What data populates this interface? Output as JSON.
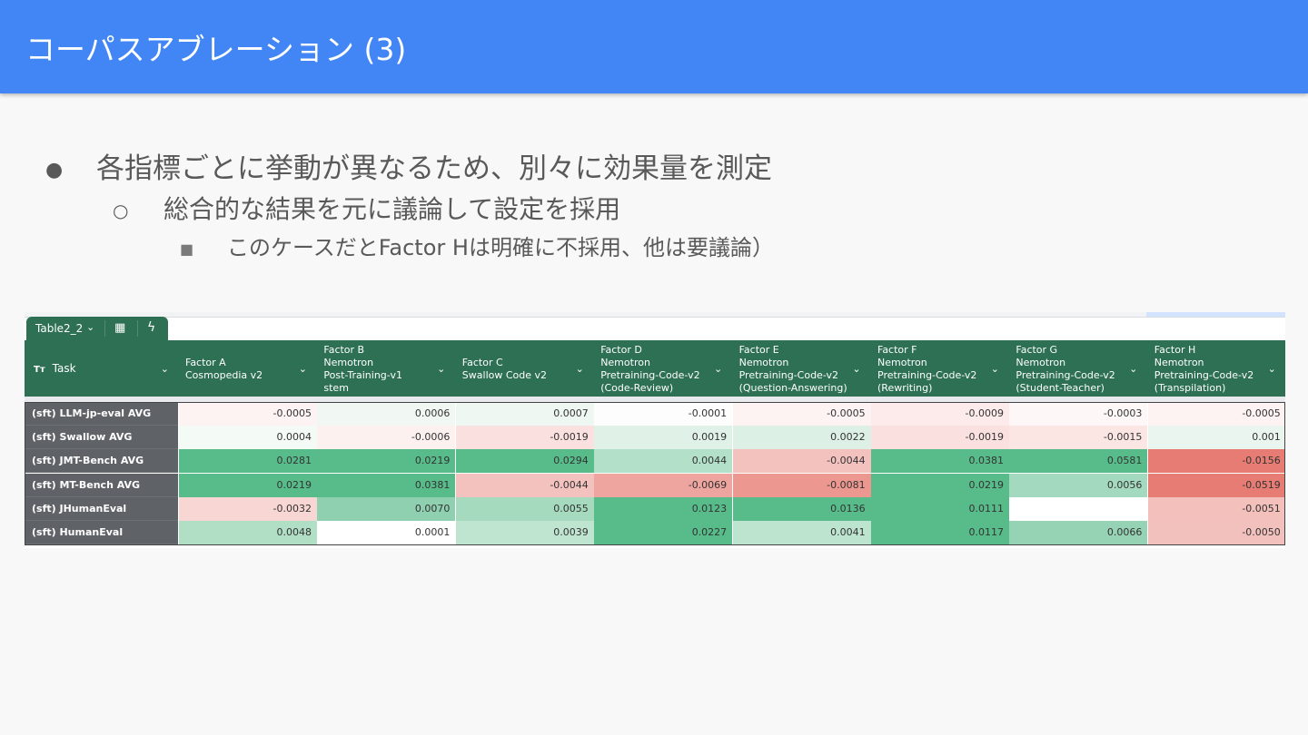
{
  "header": {
    "title": "コーパスアブレーション (3)"
  },
  "bullets": {
    "level1": {
      "marker": "●",
      "text": "各指標ごとに挙動が異なるため、別々に効果量を測定"
    },
    "level2": {
      "marker": "○",
      "text": "総合的な結果を元に議論して設定を採用"
    },
    "level3": {
      "marker": "■",
      "text": "このケースだとFactor Hは明確に不採用、他は要議論）"
    }
  },
  "sheet": {
    "tab": {
      "name": "Table2_2",
      "chevron_icon": "chevron-down-icon",
      "grid_icon": "table-grid-icon",
      "bolt_icon": "bolt-icon"
    },
    "task_header": {
      "type_icon": "Tт",
      "label": "Task"
    },
    "columns": [
      "Factor A\nCosmopedia v2",
      "Factor B\nNemotron\nPost-Training-v1\nstem",
      "Factor C\nSwallow Code v2",
      "Factor D\nNemotron\nPretraining-Code-v2\n(Code-Review)",
      "Factor E\nNemotron\nPretraining-Code-v2\n(Question-Answering)",
      "Factor F\nNemotron\nPretraining-Code-v2\n(Rewriting)",
      "Factor G\nNemotron\nPretraining-Code-v2\n(Student-Teacher)",
      "Factor H\nNemotron\nPretraining-Code-v2\n(Transpilation)"
    ],
    "rows": [
      {
        "label": "(sft) LLM-jp-eval AVG",
        "values": [
          "-0.0005",
          "0.0006",
          "0.0007",
          "-0.0001",
          "-0.0005",
          "-0.0009",
          "-0.0003",
          "-0.0005"
        ],
        "colors": [
          "#fdf3f2",
          "#f1f8f4",
          "#eef7f2",
          "#fefdfd",
          "#fdf3f2",
          "#fcebea",
          "#fdf7f7",
          "#fdf3f2"
        ]
      },
      {
        "label": "(sft) Swallow AVG",
        "values": [
          "0.0004",
          "-0.0006",
          "-0.0019",
          "0.0019",
          "0.0022",
          "-0.0019",
          "-0.0015",
          "0.001"
        ],
        "colors": [
          "#f4faf6",
          "#fdf1f0",
          "#fae1df",
          "#e0f1e7",
          "#ddf0e5",
          "#fae1df",
          "#fbe6e4",
          "#eaf5ef"
        ]
      },
      {
        "label": "(sft) JMT-Bench AVG",
        "values": [
          "0.0281",
          "0.0219",
          "0.0294",
          "0.0044",
          "-0.0044",
          "0.0381",
          "0.0581",
          "-0.0156"
        ],
        "colors": [
          "#57bb8a",
          "#57bb8a",
          "#57bb8a",
          "#b3e0c8",
          "#f3c2be",
          "#57bb8a",
          "#57bb8a",
          "#e67c73"
        ]
      },
      {
        "label": "(sft) MT-Bench AVG",
        "values": [
          "0.0219",
          "0.0381",
          "-0.0044",
          "-0.0069",
          "-0.0081",
          "0.0219",
          "0.0056",
          "-0.0519"
        ],
        "colors": [
          "#57bb8a",
          "#57bb8a",
          "#f3c2be",
          "#eea59f",
          "#ec9891",
          "#57bb8a",
          "#a3d9be",
          "#e67c73"
        ]
      },
      {
        "label": "(sft) JHumanEval",
        "values": [
          "-0.0032",
          "0.0070",
          "0.0055",
          "0.0123",
          "0.0136",
          "0.0111",
          "",
          "-0.0051"
        ],
        "colors": [
          "#f7d6d3",
          "#8ed0af",
          "#a5dabf",
          "#57bb8a",
          "#57bb8a",
          "#57bb8a",
          "#ffffff",
          "#f3c0bc"
        ]
      },
      {
        "label": "(sft) HumanEval",
        "values": [
          "0.0048",
          "0.0001",
          "0.0039",
          "0.0227",
          "0.0041",
          "0.0117",
          "0.0066",
          "-0.0050"
        ],
        "colors": [
          "#b0dfc6",
          "#ffffff",
          "#bfe5d1",
          "#57bb8a",
          "#bce4cf",
          "#57bb8a",
          "#95d3b4",
          "#f3c1bd"
        ]
      }
    ]
  }
}
